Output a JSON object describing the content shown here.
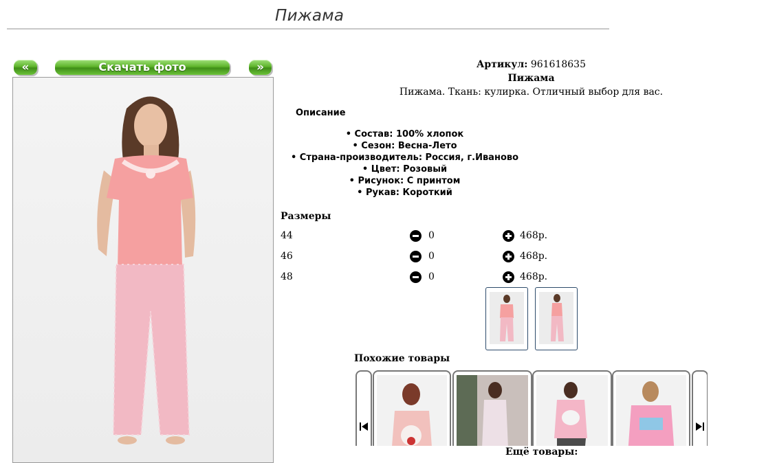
{
  "page": {
    "title": "Пижама"
  },
  "nav": {
    "prev_label": "«",
    "download_label": "Скачать фото",
    "next_label": "»"
  },
  "product": {
    "article_label": "Артикул:",
    "article_value": "961618635",
    "name": "Пижама",
    "summary": "Пижама. Ткань: кулирка. Отличный выбор для вас."
  },
  "description": {
    "title": "Описание",
    "items": [
      "• Состав: 100% хлопок",
      "• Сезон: Весна-Лето",
      "• Страна-производитель: Россия, г.Иваново",
      "• Цвет: Розовый",
      "• Рисунок: С принтом",
      "• Рукав: Короткий"
    ]
  },
  "sizes": {
    "title": "Размеры",
    "rows": [
      {
        "size": "44",
        "qty": "0",
        "price": "468р."
      },
      {
        "size": "46",
        "qty": "0",
        "price": "468р."
      },
      {
        "size": "48",
        "qty": "0",
        "price": "468р."
      }
    ]
  },
  "similar": {
    "title": "Похожие товары"
  },
  "more": {
    "title": "Ещё товары:"
  },
  "icons": {
    "minus": "minus-circle-icon",
    "plus": "plus-circle-icon",
    "carousel_prev": "skip-back-icon",
    "carousel_next": "skip-forward-icon"
  },
  "colors": {
    "button_green": "#5eb52c",
    "shirt_pink": "#f5a0a0",
    "pants_pink": "#f2b9c4",
    "rule_gray": "#c8c8c8"
  }
}
